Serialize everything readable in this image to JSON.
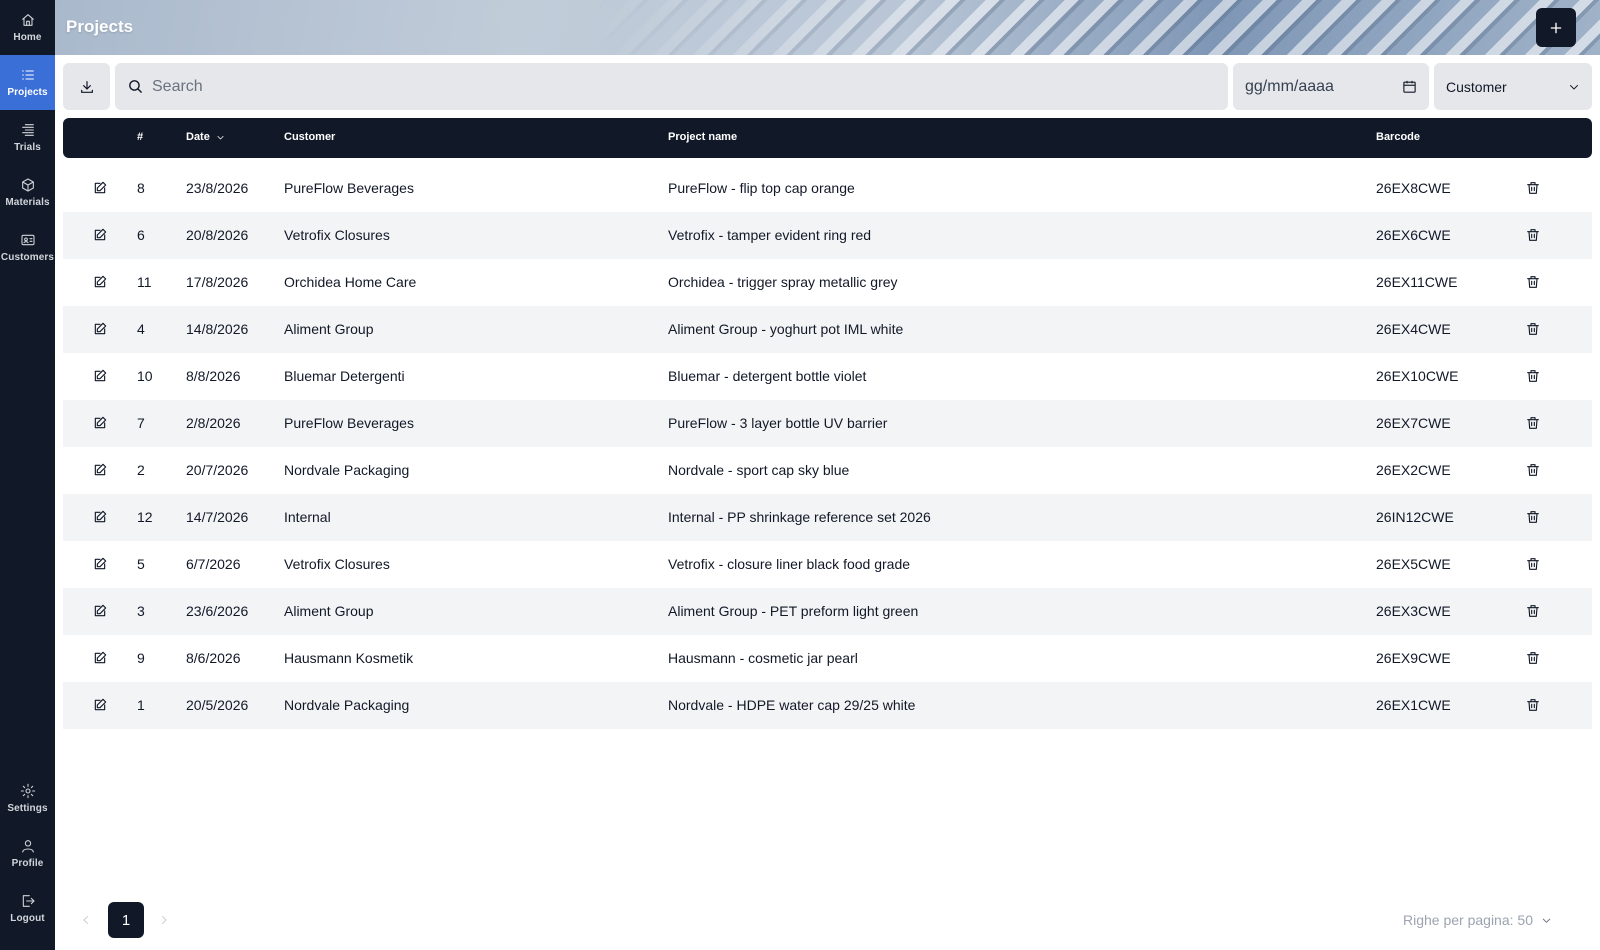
{
  "sidebar": {
    "top_items": [
      {
        "label": "Home",
        "icon": "home-icon",
        "active": false
      },
      {
        "label": "Projects",
        "icon": "list-icon",
        "active": true
      },
      {
        "label": "Trials",
        "icon": "list-details-icon",
        "active": false
      },
      {
        "label": "Materials",
        "icon": "box-icon",
        "active": false
      },
      {
        "label": "Customers",
        "icon": "id-card-icon",
        "active": false
      }
    ],
    "bottom_items": [
      {
        "label": "Settings",
        "icon": "gear-icon"
      },
      {
        "label": "Profile",
        "icon": "user-icon"
      },
      {
        "label": "Logout",
        "icon": "logout-icon"
      }
    ]
  },
  "header": {
    "title": "Projects",
    "add_icon": "plus-icon"
  },
  "toolbar": {
    "download_icon": "download-icon",
    "search_placeholder": "Search",
    "date_placeholder": "gg/mm/aaaa",
    "customer_select": "Customer"
  },
  "table": {
    "columns": {
      "num": "#",
      "date": "Date",
      "customer": "Customer",
      "project": "Project name",
      "barcode": "Barcode"
    },
    "sort": {
      "column": "date",
      "direction": "desc"
    },
    "rows": [
      {
        "num": "8",
        "date": "23/8/2026",
        "customer": "PureFlow Beverages",
        "project": "PureFlow - flip top cap orange",
        "barcode": "26EX8CWE"
      },
      {
        "num": "6",
        "date": "20/8/2026",
        "customer": "Vetrofix Closures",
        "project": "Vetrofix - tamper evident ring red",
        "barcode": "26EX6CWE"
      },
      {
        "num": "11",
        "date": "17/8/2026",
        "customer": "Orchidea Home Care",
        "project": "Orchidea - trigger spray metallic grey",
        "barcode": "26EX11CWE"
      },
      {
        "num": "4",
        "date": "14/8/2026",
        "customer": "Aliment Group",
        "project": "Aliment Group - yoghurt pot IML white",
        "barcode": "26EX4CWE"
      },
      {
        "num": "10",
        "date": "8/8/2026",
        "customer": "Bluemar Detergenti",
        "project": "Bluemar - detergent bottle violet",
        "barcode": "26EX10CWE"
      },
      {
        "num": "7",
        "date": "2/8/2026",
        "customer": "PureFlow Beverages",
        "project": "PureFlow - 3 layer bottle UV barrier",
        "barcode": "26EX7CWE"
      },
      {
        "num": "2",
        "date": "20/7/2026",
        "customer": "Nordvale Packaging",
        "project": "Nordvale - sport cap sky blue",
        "barcode": "26EX2CWE"
      },
      {
        "num": "12",
        "date": "14/7/2026",
        "customer": "Internal",
        "project": "Internal - PP shrinkage reference set 2026",
        "barcode": "26IN12CWE"
      },
      {
        "num": "5",
        "date": "6/7/2026",
        "customer": "Vetrofix Closures",
        "project": "Vetrofix - closure liner black food grade",
        "barcode": "26EX5CWE"
      },
      {
        "num": "3",
        "date": "23/6/2026",
        "customer": "Aliment Group",
        "project": "Aliment Group - PET preform light green",
        "barcode": "26EX3CWE"
      },
      {
        "num": "9",
        "date": "8/6/2026",
        "customer": "Hausmann Kosmetik",
        "project": "Hausmann - cosmetic jar pearl",
        "barcode": "26EX9CWE"
      },
      {
        "num": "1",
        "date": "20/5/2026",
        "customer": "Nordvale Packaging",
        "project": "Nordvale - HDPE water cap 29/25 white",
        "barcode": "26EX1CWE"
      }
    ]
  },
  "pagination": {
    "current_page": "1",
    "rows_per_page": "Righe per pagina: 50"
  },
  "colors": {
    "sidebar_bg": "#111827",
    "active_nav": "#3b6fd8",
    "header_dark": "#111827",
    "row_alt": "#f3f4f6",
    "input_bg": "#e5e7eb"
  }
}
